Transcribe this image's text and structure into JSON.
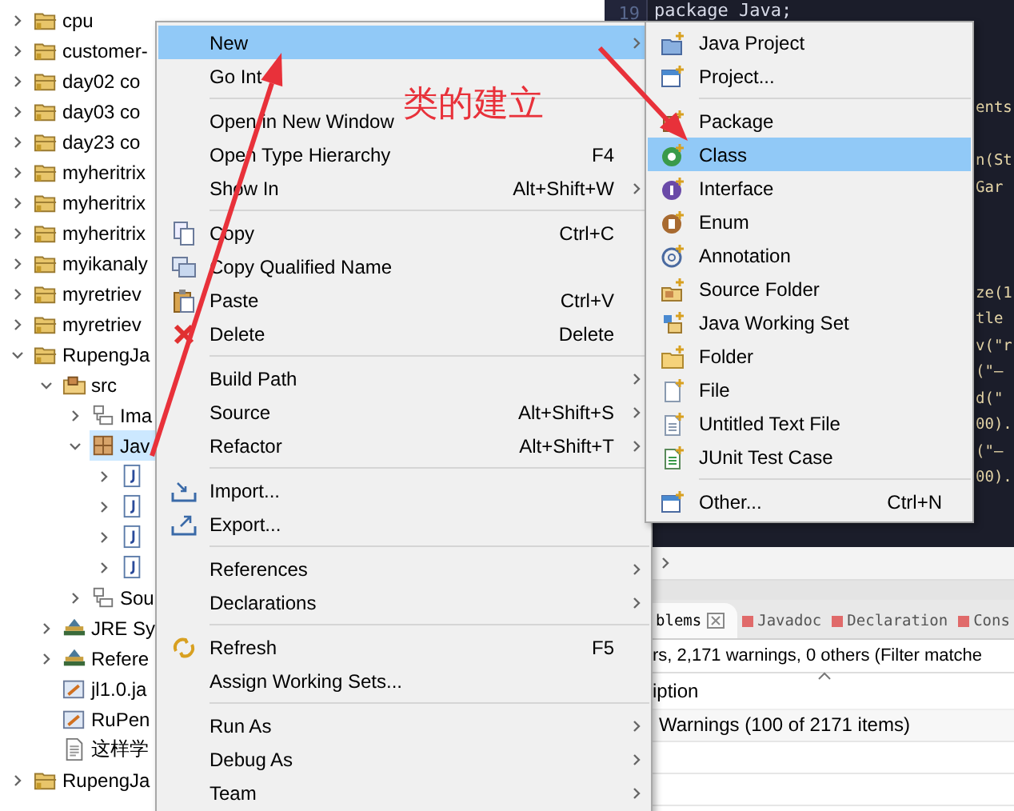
{
  "tree": [
    {
      "label": "cpu",
      "kind": "project",
      "expandable": true,
      "expanded": false,
      "selected": false
    },
    {
      "label": "customer-",
      "kind": "project",
      "expandable": true,
      "expanded": false,
      "selected": false
    },
    {
      "label": "day02 co",
      "kind": "project",
      "expandable": true,
      "expanded": false,
      "selected": false
    },
    {
      "label": "day03 co",
      "kind": "project",
      "expandable": true,
      "expanded": false,
      "selected": false
    },
    {
      "label": "day23 co",
      "kind": "project",
      "expandable": true,
      "expanded": false,
      "selected": false
    },
    {
      "label": "myheritrix",
      "kind": "project",
      "expandable": true,
      "expanded": false,
      "selected": false
    },
    {
      "label": "myheritrix",
      "kind": "project",
      "expandable": true,
      "expanded": false,
      "selected": false
    },
    {
      "label": "myheritrix",
      "kind": "project",
      "expandable": true,
      "expanded": false,
      "selected": false
    },
    {
      "label": "myikanaly",
      "kind": "project",
      "expandable": true,
      "expanded": false,
      "selected": false
    },
    {
      "label": "myretriev",
      "kind": "project",
      "expandable": true,
      "expanded": false,
      "selected": false
    },
    {
      "label": "myretriev",
      "kind": "project",
      "expandable": true,
      "expanded": false,
      "selected": false
    },
    {
      "label": "RupengJa",
      "kind": "project",
      "expandable": true,
      "expanded": true,
      "selected": false,
      "children": [
        {
          "label": "src",
          "kind": "source-folder",
          "expandable": true,
          "expanded": true,
          "selected": false,
          "children": [
            {
              "label": "Ima",
              "kind": "package-tree",
              "expandable": true,
              "expanded": false,
              "selected": false
            },
            {
              "label": "Jav",
              "kind": "package",
              "expandable": true,
              "expanded": true,
              "selected": true,
              "children": [
                {
                  "kind": "java-file",
                  "expandable": true,
                  "expanded": false,
                  "selected": false
                },
                {
                  "kind": "java-file",
                  "expandable": true,
                  "expanded": false,
                  "selected": false
                },
                {
                  "kind": "java-file",
                  "expandable": true,
                  "expanded": false,
                  "selected": false
                },
                {
                  "kind": "java-file",
                  "expandable": true,
                  "expanded": false,
                  "selected": false
                }
              ]
            },
            {
              "label": "Sou",
              "kind": "package-tree",
              "expandable": true,
              "expanded": false,
              "selected": false
            }
          ]
        },
        {
          "label": "JRE Sy",
          "kind": "library",
          "expandable": true,
          "expanded": false,
          "selected": false
        },
        {
          "label": "Refere",
          "kind": "library",
          "expandable": true,
          "expanded": false,
          "selected": false
        },
        {
          "label": "jl1.0.ja",
          "kind": "jar",
          "expandable": false,
          "expanded": false,
          "selected": false
        },
        {
          "label": "RuPen",
          "kind": "jar",
          "expandable": false,
          "expanded": false,
          "selected": false
        },
        {
          "label": "这样学",
          "kind": "text-file",
          "expandable": false,
          "expanded": false,
          "selected": false
        }
      ]
    },
    {
      "label": "RupengJa",
      "kind": "project",
      "expandable": true,
      "expanded": false,
      "selected": false
    }
  ],
  "editor": {
    "line_number": "19",
    "lines": [
      {
        "text": "package Java;",
        "kind": "full"
      },
      {
        "text": "ents",
        "kind": "edge"
      },
      {
        "text": "n(St",
        "kind": "edge"
      },
      {
        "text": "Gar",
        "kind": "edge"
      },
      {
        "text": "ze(1",
        "kind": "edge"
      },
      {
        "text": "tle",
        "kind": "edge"
      },
      {
        "text": "v(\"r",
        "kind": "edge"
      },
      {
        "text": "(\"—",
        "kind": "edge"
      },
      {
        "text": "d(\"",
        "kind": "edge"
      },
      {
        "text": "00).",
        "kind": "edge"
      },
      {
        "text": "(\"—",
        "kind": "edge"
      },
      {
        "text": "00).",
        "kind": "edge"
      }
    ]
  },
  "problems": {
    "tabs": [
      {
        "label": "blems",
        "selected": true
      },
      {
        "label": "Javadoc",
        "selected": false
      },
      {
        "label": "Declaration",
        "selected": false
      },
      {
        "label": "Cons",
        "selected": false
      }
    ],
    "summary": "rs, 2,171 warnings, 0 others (Filter matche",
    "column": "iption",
    "rows": [
      "Warnings (100 of 2171 items)"
    ]
  },
  "context_menu": {
    "sections": [
      [
        {
          "label": "New",
          "submenu": true,
          "selected": true
        },
        {
          "label": "Go Int",
          "submenu": false,
          "selected": false
        }
      ],
      [
        {
          "label": "Open in New Window",
          "submenu": false,
          "selected": false
        },
        {
          "label": "Open Type Hierarchy",
          "shortcut": "F4",
          "submenu": false,
          "selected": false
        },
        {
          "label": "Show In",
          "shortcut": "Alt+Shift+W",
          "submenu": true,
          "selected": false
        }
      ],
      [
        {
          "label": "Copy",
          "shortcut": "Ctrl+C",
          "submenu": false,
          "selected": false
        },
        {
          "label": "Copy Qualified Name",
          "submenu": false,
          "selected": false
        },
        {
          "label": "Paste",
          "shortcut": "Ctrl+V",
          "submenu": false,
          "selected": false
        },
        {
          "label": "Delete",
          "shortcut": "Delete",
          "submenu": false,
          "selected": false
        }
      ],
      [
        {
          "label": "Build Path",
          "submenu": true,
          "selected": false
        },
        {
          "label": "Source",
          "shortcut": "Alt+Shift+S",
          "submenu": true,
          "selected": false
        },
        {
          "label": "Refactor",
          "shortcut": "Alt+Shift+T",
          "submenu": true,
          "selected": false
        }
      ],
      [
        {
          "label": "Import...",
          "submenu": false,
          "selected": false
        },
        {
          "label": "Export...",
          "submenu": false,
          "selected": false
        }
      ],
      [
        {
          "label": "References",
          "submenu": true,
          "selected": false
        },
        {
          "label": "Declarations",
          "submenu": true,
          "selected": false
        }
      ],
      [
        {
          "label": "Refresh",
          "shortcut": "F5",
          "submenu": false,
          "selected": false
        },
        {
          "label": "Assign Working Sets...",
          "submenu": false,
          "selected": false
        }
      ],
      [
        {
          "label": "Run As",
          "submenu": true,
          "selected": false
        },
        {
          "label": "Debug As",
          "submenu": true,
          "selected": false
        },
        {
          "label": "Team",
          "submenu": true,
          "selected": false
        }
      ]
    ]
  },
  "submenu": {
    "sections": [
      [
        {
          "label": "Java Project",
          "selected": false
        },
        {
          "label": "Project...",
          "selected": false
        }
      ],
      [
        {
          "label": "Package",
          "selected": false
        },
        {
          "label": "Class",
          "selected": true
        },
        {
          "label": "Interface",
          "selected": false
        },
        {
          "label": "Enum",
          "selected": false
        },
        {
          "label": "Annotation",
          "selected": false
        },
        {
          "label": "Source Folder",
          "selected": false
        },
        {
          "label": "Java Working Set",
          "selected": false
        },
        {
          "label": "Folder",
          "selected": false
        },
        {
          "label": "File",
          "selected": false
        },
        {
          "label": "Untitled Text File",
          "selected": false
        },
        {
          "label": "JUnit Test Case",
          "selected": false
        }
      ],
      [
        {
          "label": "Other...",
          "shortcut": "Ctrl+N",
          "selected": false
        }
      ]
    ]
  },
  "annotation": {
    "text": "类的建立"
  }
}
